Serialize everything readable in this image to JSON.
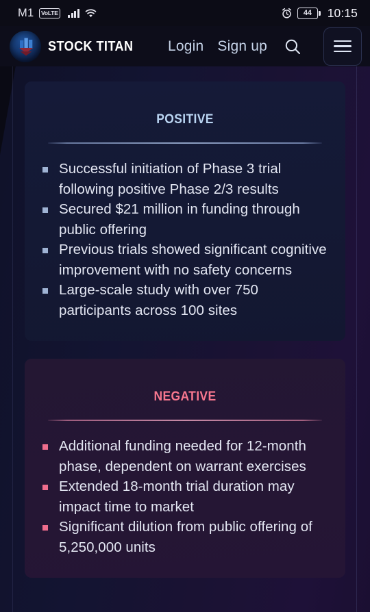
{
  "statusbar": {
    "carrier": "M1",
    "volte_label": "VoLTE",
    "signal_icon": "signal-bars-icon",
    "wifi_icon": "wifi-icon",
    "alarm_icon": "alarm-clock-icon",
    "battery_level": "44",
    "time": "10:15"
  },
  "navbar": {
    "logo_icon": "stock-titan-logo-icon",
    "brand": "STOCK TITAN",
    "login_label": "Login",
    "signup_label": "Sign up",
    "search_icon": "search-icon",
    "menu_icon": "hamburger-menu-icon"
  },
  "cards": [
    {
      "id": "positive",
      "title": "Positive",
      "accent": "#bad5f2",
      "bullet_color": "#9fb3d4",
      "points": [
        "Successful initiation of Phase 3 trial following positive Phase 2/3 results",
        "Secured $21 million in funding through public offering",
        "Previous trials showed significant cognitive improvement with no safety concerns",
        "Large-scale study with over 750 participants across 100 sites"
      ]
    },
    {
      "id": "negative",
      "title": "Negative",
      "accent": "#f8778f",
      "bullet_color": "#ef6d8d",
      "points": [
        "Additional funding needed for 12-month phase, dependent on warrant exercises",
        "Extended 18-month trial duration may impact time to market",
        "Significant dilution from public offering of 5,250,000 units"
      ]
    }
  ]
}
